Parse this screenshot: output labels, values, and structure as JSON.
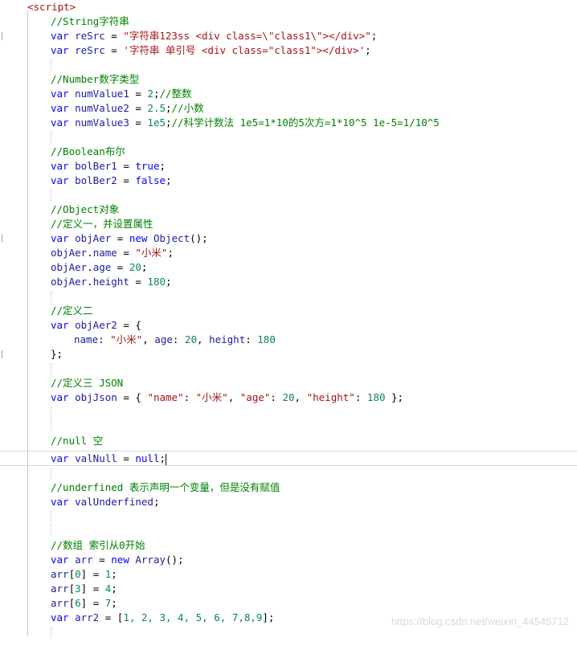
{
  "editor": {
    "script_tag": "<script>",
    "lines": {
      "c_string": "//String字符串",
      "v_resrc1_decl": "var ",
      "v_resrc1_name": "reSrc",
      "v_resrc1_val": "\"字符串123ss <div class=\\\"class1\\\"></div>\"",
      "v_resrc2_val": "'字符串 单引号 <div class=\"class1\"></div>'",
      "c_number": "//Number数字类型",
      "num1_name": "numValue1",
      "num1_val": "2",
      "num1_cm": "//整数",
      "num2_name": "numValue2",
      "num2_val": "2.5",
      "num2_cm": "//小数",
      "num3_name": "numValue3",
      "num3_val": "1e5",
      "num3_cm": "//科学计数法 1e5=1*10的5次方=1*10^5 1e-5=1/10^5",
      "c_boolean": "//Boolean布尔",
      "bol1_name": "bolBer1",
      "bol2_name": "bolBer2",
      "true_kw": "true",
      "false_kw": "false",
      "c_object": "//Object对象",
      "c_def1": "//定义一，并设置属性",
      "objaer_name": "objAer",
      "new_kw": "new",
      "object_ctor": "Object",
      "name_prop": "name",
      "name_val": "\"小米\"",
      "age_prop": "age",
      "age_val": "20",
      "height_prop": "height",
      "height_val": "180",
      "c_def2": "//定义二",
      "objaer2_name": "objAer2",
      "c_def3": "//定义三 JSON",
      "objjson_name": "objJson",
      "json_name_key": "\"name\"",
      "json_age_key": "\"age\"",
      "json_height_key": "\"height\"",
      "c_null": "//null 空",
      "valnull_name": "valNull",
      "null_kw": "null",
      "c_undefined": "//underfined 表示声明一个变量，但是没有赋值",
      "valund_name": "valUnderfined",
      "c_array": "//数组 索引从0开始",
      "arr_name": "arr",
      "array_ctor": "Array",
      "arr0_idx": "0",
      "arr0_val": "1",
      "arr3_idx": "3",
      "arr3_val": "4",
      "arr6_idx": "6",
      "arr6_val": "7",
      "arr2_name": "arr2",
      "arr2_vals": "1, 2, 3, 4, 5, 6, 7,8,9"
    }
  },
  "watermark": "https://blog.csdn.net/weixin_44545712",
  "colors": {
    "keyword": "#0000ff",
    "comment": "#008000",
    "string": "#a31515",
    "number": "#098658",
    "identifier": "#1c1c9c"
  }
}
